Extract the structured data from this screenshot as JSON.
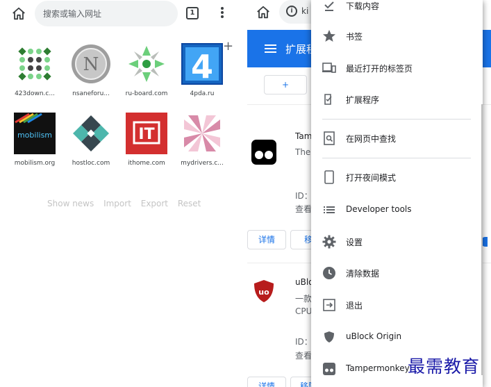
{
  "left": {
    "search_placeholder": "搜索或输入网址",
    "tab_count": "1",
    "tiles": [
      {
        "label": "423down.c..."
      },
      {
        "label": "nsaneforu..."
      },
      {
        "label": "ru-board.com"
      },
      {
        "label": "4pda.ru"
      },
      {
        "label": "mobilism.org"
      },
      {
        "label": "hostloc.com"
      },
      {
        "label": "ithome.com"
      },
      {
        "label": "mydrivers.c..."
      }
    ],
    "tile_logo_text": {
      "nsane": "N",
      "fourpda": "4",
      "mobilism": "mobilism",
      "ithome": "IT"
    },
    "add_symbol": "+",
    "actions": [
      "Show news",
      "Import",
      "Export",
      "Reset"
    ]
  },
  "right": {
    "url_text": "ki",
    "page_title": "扩展程",
    "add_button": "+",
    "ext1": {
      "name": "Tam",
      "desc": "The",
      "id_label": "ID：",
      "view": "查看",
      "details_btn": "详情",
      "remove_btn": "移"
    },
    "ext2": {
      "name": "uBlo",
      "desc1": "一款",
      "desc2": "CPU",
      "id_label": "ID：",
      "view": "查看",
      "details_btn": "详情",
      "remove_btn": "移除"
    },
    "ublock_logo_text": "uo"
  },
  "menu": {
    "items": [
      {
        "label": "下载内容",
        "icon": "download-done-icon"
      },
      {
        "label": "书签",
        "icon": "star-icon"
      },
      {
        "label": "最近打开的标签页",
        "icon": "devices-icon"
      },
      {
        "label": "扩展程序",
        "icon": "extension-icon"
      },
      {
        "label": "在网页中查找",
        "icon": "find-in-page-icon"
      },
      {
        "label": "打开夜间模式",
        "icon": "phone-icon"
      },
      {
        "label": "Developer tools",
        "icon": "list-icon"
      },
      {
        "label": "设置",
        "icon": "gear-icon"
      },
      {
        "label": "清除数据",
        "icon": "history-icon"
      },
      {
        "label": "退出",
        "icon": "exit-icon"
      },
      {
        "label": "uBlock Origin",
        "icon": "shield-icon"
      },
      {
        "label": "Tampermonkey",
        "icon": "tampermonkey-icon"
      }
    ]
  },
  "watermark": "最需教育",
  "colors": {
    "accent": "#1a73e8",
    "text": "#202124",
    "muted": "#c4c4c4"
  }
}
